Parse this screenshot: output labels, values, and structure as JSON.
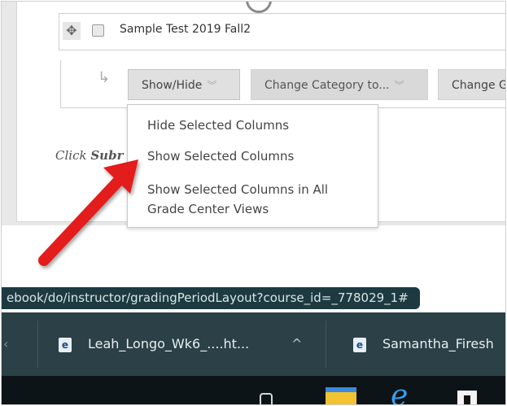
{
  "column_row": {
    "drag_handle_icon": "move-icon",
    "title": "Sample Test 2019 Fall2"
  },
  "action_bar": {
    "show_hide_label": "Show/Hide",
    "change_category_label": "Change Category to...",
    "change_label": "Change G"
  },
  "dropdown": {
    "items": [
      "Hide Selected Columns",
      "Show Selected Columns",
      "Show Selected Columns in All",
      "Grade Center Views"
    ]
  },
  "instruction": {
    "prefix": "Click ",
    "bold": "Subr"
  },
  "status_url": "ebook/do/instructor/gradingPeriodLayout?course_id=_778029_1#",
  "taskbar": {
    "items": [
      {
        "label": "Leah_Longo_Wk6_....ht...",
        "icon": "document-icon",
        "glyph": "e"
      },
      {
        "label": "Samantha_Firesh",
        "icon": "document-icon",
        "glyph": "e"
      }
    ],
    "expand_glyph": "^"
  },
  "colors": {
    "annotation_arrow": "#e31b1b",
    "taskbar": "#2b4047",
    "status_bar": "#1d3a41"
  }
}
